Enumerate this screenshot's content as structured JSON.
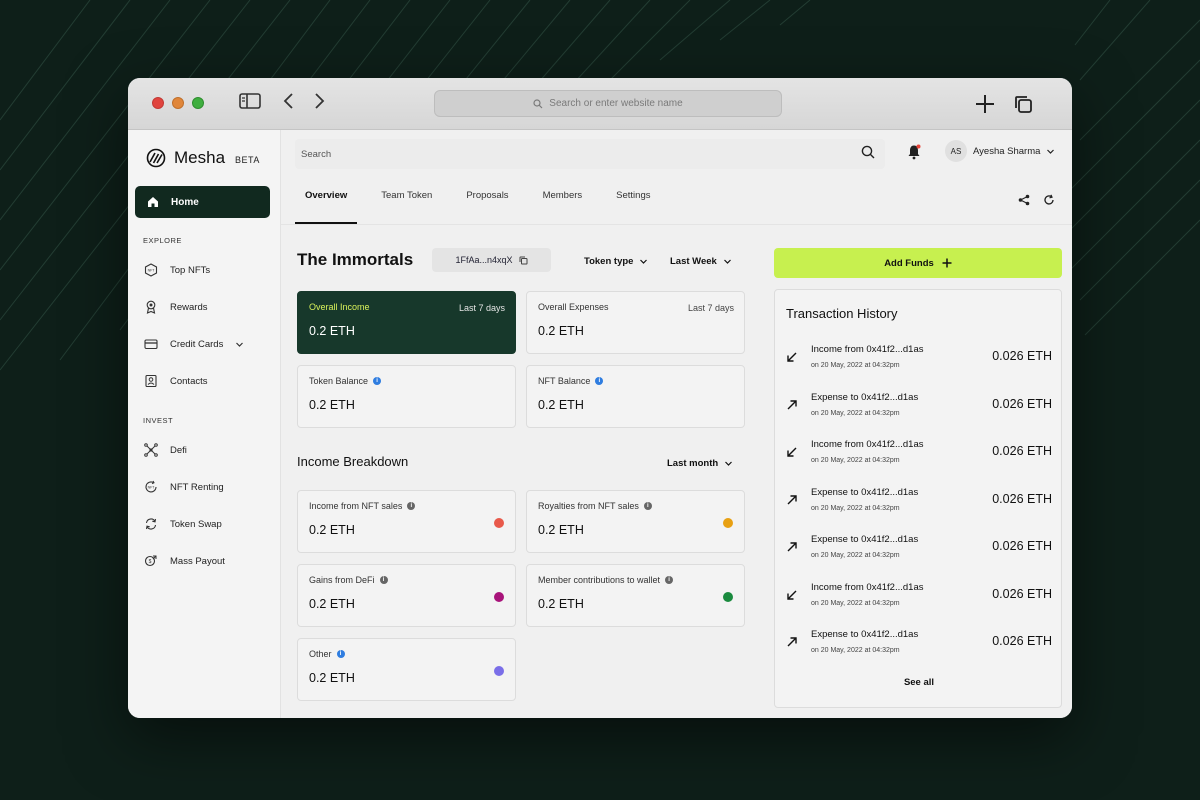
{
  "browser": {
    "url_placeholder": "Search or enter website name"
  },
  "brand": {
    "name": "Mesha",
    "badge": "BETA"
  },
  "sidebar": {
    "home_label": "Home",
    "explore_label": "EXPLORE",
    "explore_items": [
      {
        "label": "Top NFTs",
        "icon": "nft-icon"
      },
      {
        "label": "Rewards",
        "icon": "award-icon"
      },
      {
        "label": "Credit Cards",
        "icon": "credit-card-icon"
      },
      {
        "label": "Contacts",
        "icon": "contacts-icon"
      }
    ],
    "invest_label": "INVEST",
    "invest_items": [
      {
        "label": "Defi",
        "icon": "network-icon"
      },
      {
        "label": "NFT Renting",
        "icon": "nft-renting-icon"
      },
      {
        "label": "Token Swap",
        "icon": "swap-icon"
      },
      {
        "label": "Mass Payout",
        "icon": "payout-icon"
      }
    ]
  },
  "topbar": {
    "search_placeholder": "Search",
    "user_initials": "AS",
    "user_name": "Ayesha Sharma"
  },
  "tabs": [
    "Overview",
    "Team Token",
    "Proposals",
    "Members",
    "Settings"
  ],
  "header": {
    "title": "The Immortals",
    "token_address": "1FfAa...n4xqX",
    "token_type_label": "Token type",
    "period_label": "Last Week"
  },
  "summary_cards": [
    {
      "label": "Overall Income",
      "period": "Last 7 days",
      "value": "0.2 ETH"
    },
    {
      "label": "Overall Expenses",
      "period": "Last 7 days",
      "value": "0.2 ETH"
    },
    {
      "label": "Token Balance",
      "value": "0.2 ETH"
    },
    {
      "label": "NFT Balance",
      "value": "0.2 ETH"
    }
  ],
  "breakdown": {
    "title": "Income Breakdown",
    "period_label": "Last month",
    "items": [
      {
        "label": "Income from NFT sales",
        "value": "0.2 ETH",
        "color": "#e8594a"
      },
      {
        "label": "Royalties from NFT sales",
        "value": "0.2 ETH",
        "color": "#e8a012"
      },
      {
        "label": "Gains from DeFi",
        "value": "0.2 ETH",
        "color": "#a8137a"
      },
      {
        "label": "Member contributions to wallet",
        "value": "0.2 ETH",
        "color": "#1a8a3e"
      },
      {
        "label": "Other",
        "value": "0.2 ETH",
        "color": "#7a6ee8"
      }
    ]
  },
  "add_funds_label": "Add Funds",
  "transactions": {
    "title": "Transaction History",
    "see_all": "See all",
    "items": [
      {
        "type": "income",
        "label": "Income from 0x41f2...d1as",
        "date": "on 20 May, 2022 at 04:32pm",
        "amount": "0.026 ETH"
      },
      {
        "type": "expense",
        "label": "Expense to 0x41f2...d1as",
        "date": "on 20 May, 2022 at 04:32pm",
        "amount": "0.026 ETH"
      },
      {
        "type": "income",
        "label": "Income from 0x41f2...d1as",
        "date": "on 20 May, 2022 at 04:32pm",
        "amount": "0.026 ETH"
      },
      {
        "type": "expense",
        "label": "Expense to 0x41f2...d1as",
        "date": "on 20 May, 2022 at 04:32pm",
        "amount": "0.026 ETH"
      },
      {
        "type": "expense",
        "label": "Expense to 0x41f2...d1as",
        "date": "on 20 May, 2022 at 04:32pm",
        "amount": "0.026 ETH"
      },
      {
        "type": "income",
        "label": "Income from 0x41f2...d1as",
        "date": "on 20 May, 2022 at 04:32pm",
        "amount": "0.026 ETH"
      },
      {
        "type": "expense",
        "label": "Expense to 0x41f2...d1as",
        "date": "on 20 May, 2022 at 04:32pm",
        "amount": "0.026 ETH"
      }
    ]
  }
}
